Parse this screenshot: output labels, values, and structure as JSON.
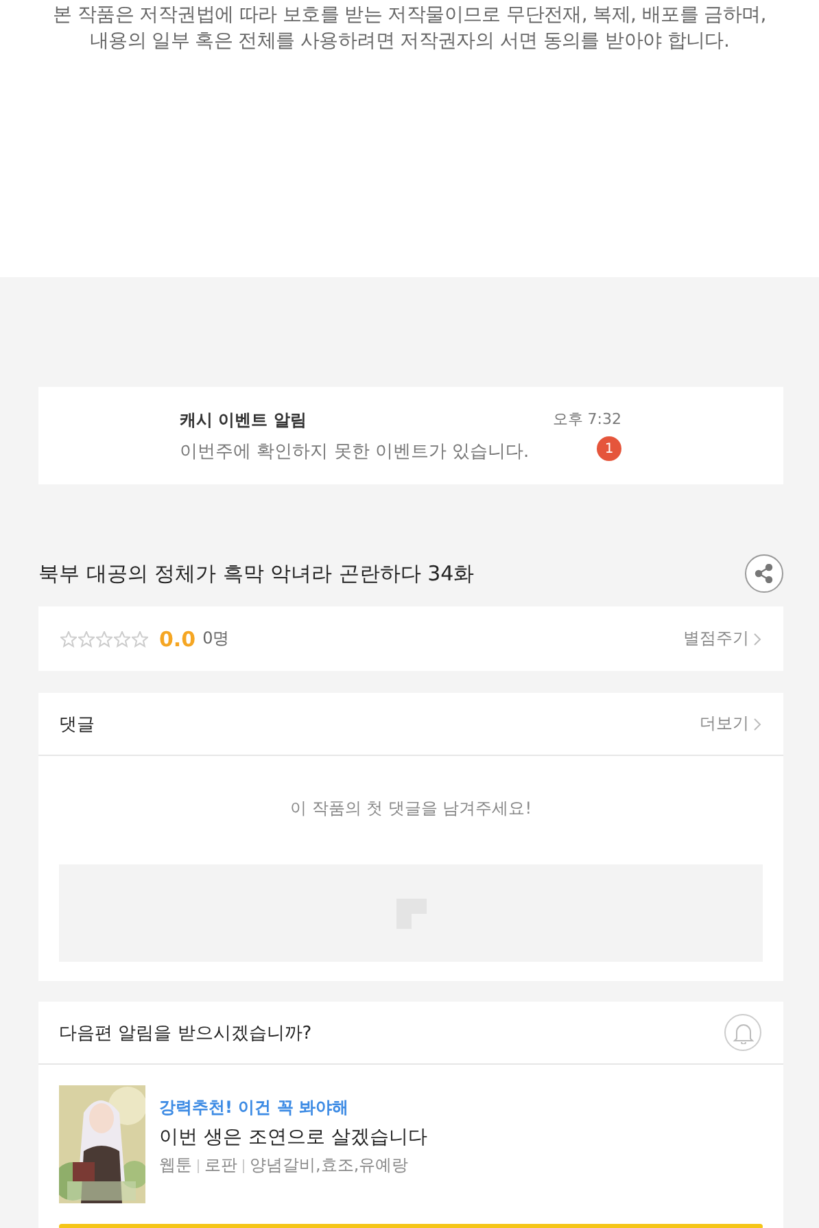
{
  "copyright": [
    "본 작품은 저작권법에 따라 보호를 받는 저작물이므로 무단전재, 복제, 배포를 금하며,",
    "내용의 일부 혹은 전체를 사용하려면 저작권자의 서면 동의를 받아야 합니다."
  ],
  "notification": {
    "title": "캐시 이벤트 알림",
    "message": "이번주에 확인하지 못한 이벤트가 있습니다.",
    "time": "오후 7:32",
    "badge": "1"
  },
  "episode_title": "북부 대공의 정체가 흑막 악녀라 곤란하다 34화",
  "rating": {
    "stars": 0,
    "score": "0.0",
    "count": "0명",
    "action": "별점주기"
  },
  "comments": {
    "title": "댓글",
    "more": "더보기",
    "empty": "이 작품의 첫 댓글을 남겨주세요!"
  },
  "next_alert": {
    "question": "다음편 알림을 받으시겠습니까?"
  },
  "recommendation": {
    "kind": "picture",
    "tagline": "강력추천! 이건 꼭 봐야해",
    "title": "이번 생은 조연으로 살겠습니다",
    "meta": [
      "웹툰",
      "로판",
      "양념갈비,효조,유예랑"
    ]
  }
}
